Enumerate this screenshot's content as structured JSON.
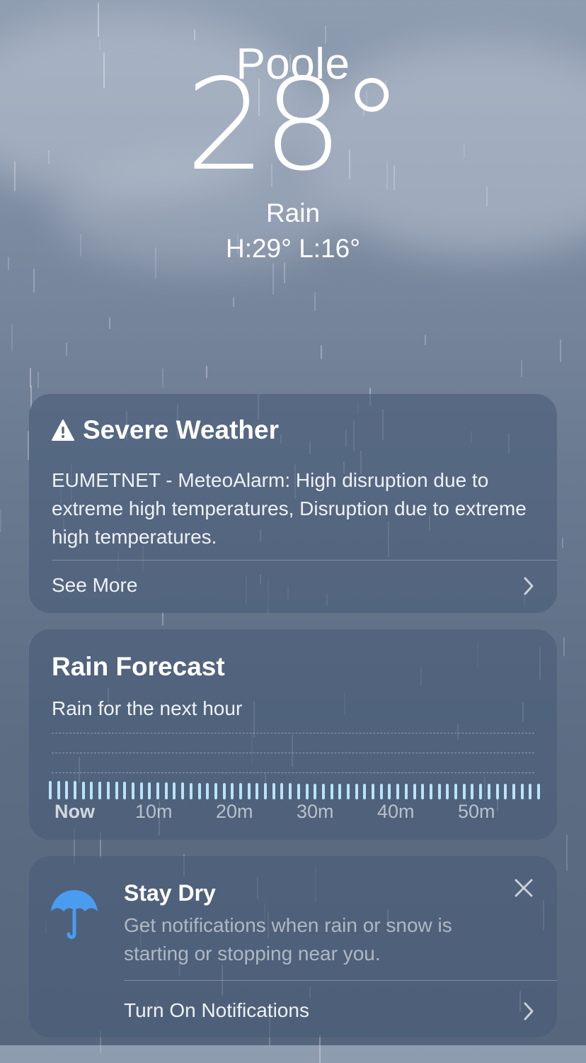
{
  "location": {
    "city": "Poole",
    "temperature": "28°",
    "condition": "Rain",
    "high_low": "H:29°  L:16°"
  },
  "severe_weather": {
    "title": "Severe Weather",
    "icon": "warning-triangle-icon",
    "message": "EUMETNET - MeteoAlarm: High disruption due to extreme high temperatures, Disruption due to extreme high temperatures.",
    "see_more_label": "See More"
  },
  "rain_forecast": {
    "title": "Rain Forecast",
    "subtitle": "Rain for the next hour",
    "time_labels": [
      "Now",
      "10m",
      "20m",
      "30m",
      "40m",
      "50m"
    ],
    "bar_color": "#b8e4ff"
  },
  "stay_dry": {
    "icon": "umbrella-icon",
    "title": "Stay Dry",
    "message": "Get notifications when rain or snow is starting or stopping near you.",
    "action_label": "Turn On Notifications",
    "umbrella_color": "#4a9cf0"
  }
}
